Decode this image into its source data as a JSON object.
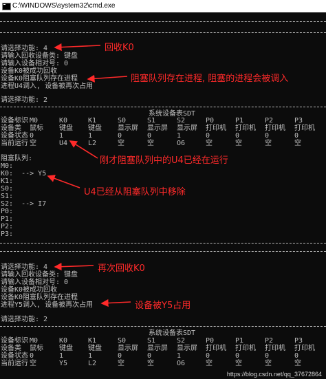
{
  "window": {
    "title": "C:\\WINDOWS\\system32\\cmd.exe"
  },
  "lines": {
    "sel_func_4a": "请选择功能: 4",
    "in_type_a": "请输入回收设备类: 键盘",
    "in_num_a": "请输入设备相对号: 0",
    "k0_ok": "设备K0被成功回收",
    "k0_blocked_a": "设备K0阻塞队列存在进程",
    "u4_in": "进程U4调入, 设备被再次占用",
    "sel_func_2a": "请选择功能: 2",
    "sdt_title_a": "系统设备表SDT",
    "block_queue": "阻塞队列:",
    "q_m0": "M0:",
    "q_k0": "K0:  --> Y5",
    "q_k1": "K1:",
    "q_s0": "S0:",
    "q_s1": "S1:",
    "q_s2": "S2:  --> I7",
    "q_p0": "P0:",
    "q_p1": "P1:",
    "q_p2": "P2:",
    "q_p3": "P3:",
    "sel_func_4b": "请选择功能: 4",
    "in_type_b": "请输入回收设备类: 键盘",
    "in_num_b": "请输入设备相对号: 0",
    "k0_blocked_b": "设备K0阻塞队列存在进程",
    "y5_in": "进程Y5调入, 设备被再次占用",
    "sel_func_2b": "请选择功能: 2",
    "sdt_title_b": "系统设备表SDT"
  },
  "sdt_a": {
    "rows": [
      [
        "设备标识",
        "M0",
        "K0",
        "K1",
        "S0",
        "S1",
        "S2",
        "P0",
        "P1",
        "P2",
        "P3"
      ],
      [
        "设备类",
        "鼠标",
        "键盘",
        "键盘",
        "显示屏",
        "显示屏",
        "显示屏",
        "打印机",
        "打印机",
        "打印机",
        "打印机"
      ],
      [
        "设备状态",
        "0",
        "1",
        "1",
        "0",
        "0",
        "1",
        "0",
        "0",
        "0",
        "0"
      ],
      [
        "当前运行",
        "空",
        "U4",
        "L2",
        "空",
        "空",
        "O6",
        "空",
        "空",
        "空",
        "空"
      ]
    ]
  },
  "sdt_b": {
    "rows": [
      [
        "设备标识",
        "M0",
        "K0",
        "K1",
        "S0",
        "S1",
        "S2",
        "P0",
        "P1",
        "P2",
        "P3"
      ],
      [
        "设备类",
        "鼠标",
        "键盘",
        "键盘",
        "显示屏",
        "显示屏",
        "显示屏",
        "打印机",
        "打印机",
        "打印机",
        "打印机"
      ],
      [
        "设备状态",
        "0",
        "1",
        "1",
        "0",
        "0",
        "1",
        "0",
        "0",
        "0",
        "0"
      ],
      [
        "当前运行",
        "空",
        "Y5",
        "L2",
        "空",
        "空",
        "O6",
        "空",
        "空",
        "空",
        "空"
      ]
    ]
  },
  "annotations": {
    "recycle_k0": "回收K0",
    "blocked_note": "阻塞队列存在进程, 阻塞的进程会被调入",
    "u4_running": "刚才阻塞队列中的U4已经在运行",
    "u4_removed": "U4已经从阻塞队列中移除",
    "recycle_k0_again": "再次回收K0",
    "y5_occupied": "设备被Y5占用"
  },
  "watermark": "https://blog.csdn.net/qq_37672864",
  "colors": {
    "annotation": "#ff2a2a",
    "console_text": "#c0c0c0",
    "background": "#0c0c0c"
  }
}
